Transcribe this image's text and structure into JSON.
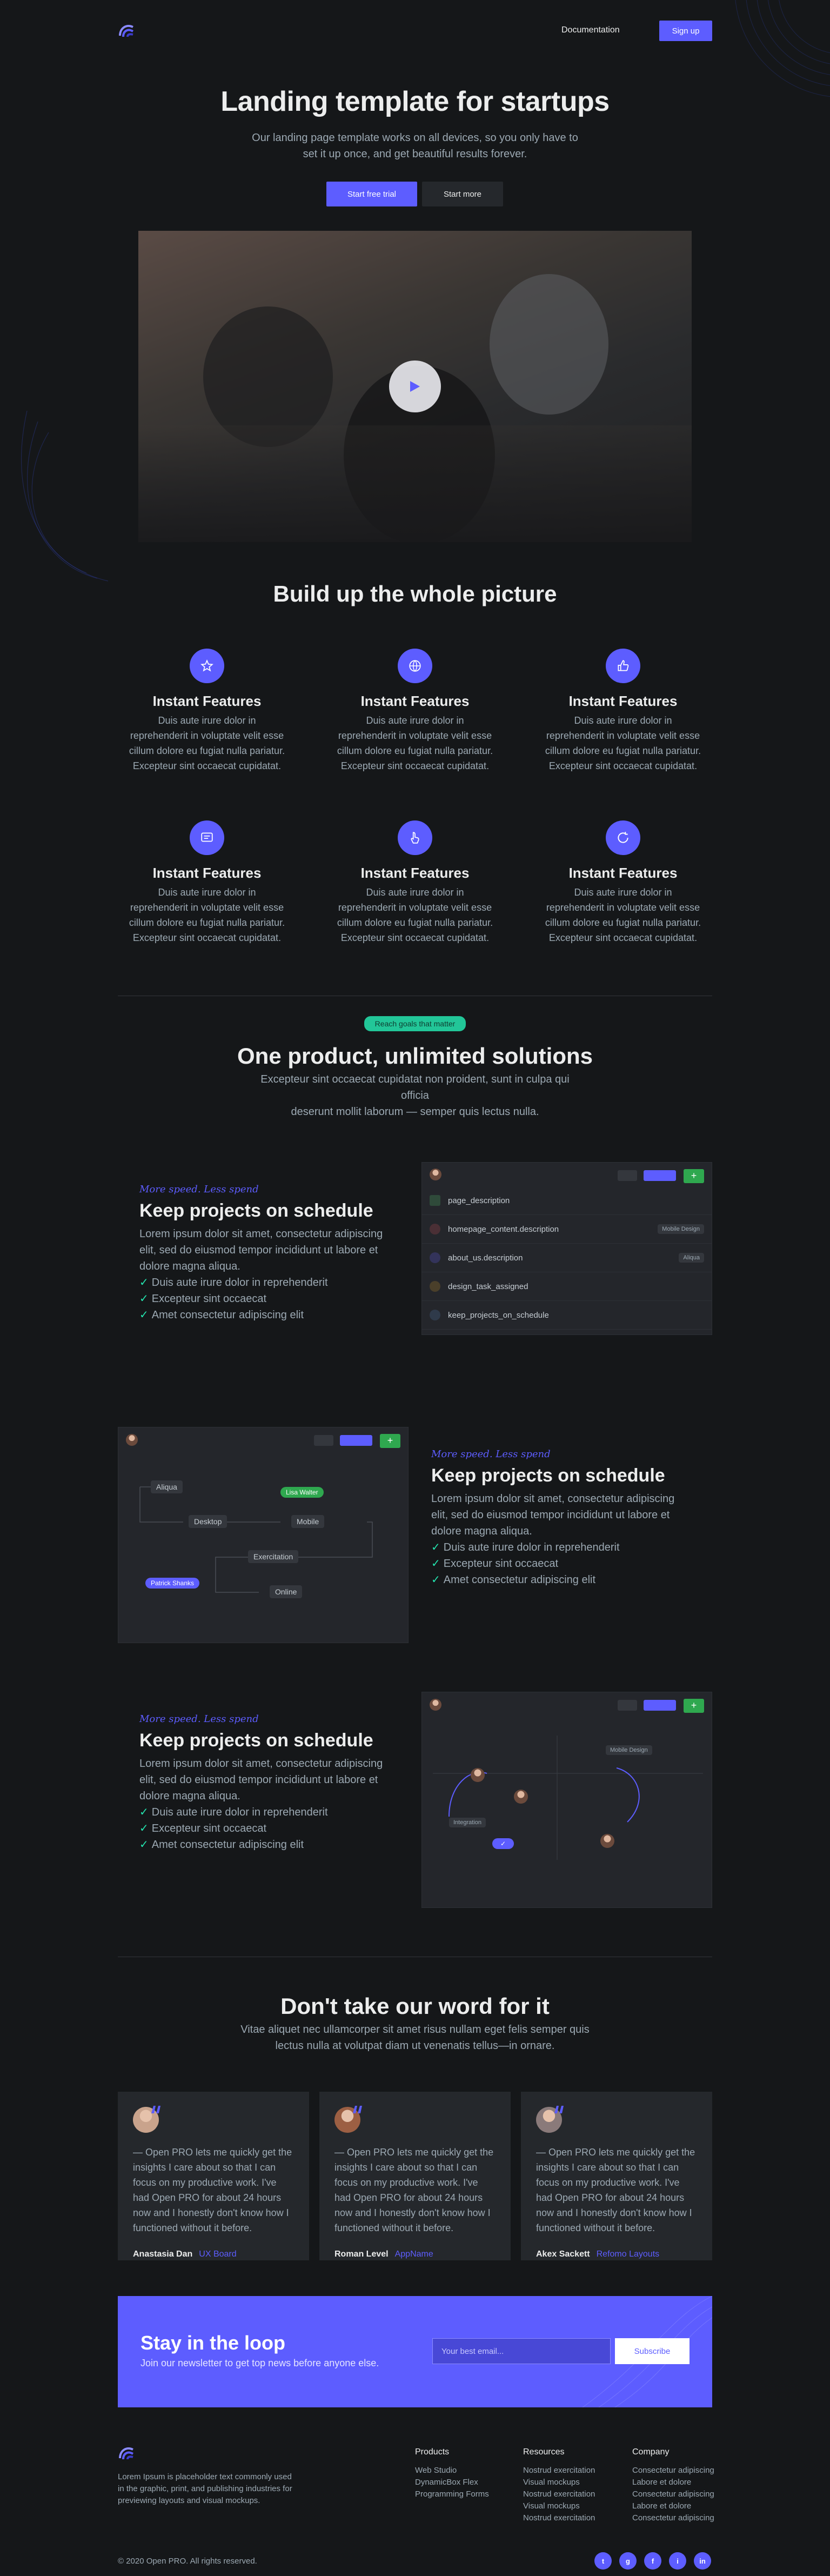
{
  "header": {
    "nav_link": "Documentation",
    "signup": "Sign up"
  },
  "hero": {
    "title": "Landing template for startups",
    "subtitle_line1": "Our landing page template works on all devices, so you only have to",
    "subtitle_line2": "set it up once, and get beautiful results forever.",
    "primary_cta": "Start free trial",
    "secondary_cta": "Start more"
  },
  "features": {
    "title": "Build up the whole picture",
    "items": [
      {
        "icon": "star-icon",
        "title": "Instant Features",
        "text": "Duis aute irure dolor in reprehenderit in voluptate velit esse cillum dolore eu fugiat nulla pariatur. Excepteur sint occaecat cupidatat."
      },
      {
        "icon": "globe-icon",
        "title": "Instant Features",
        "text": "Duis aute irure dolor in reprehenderit in voluptate velit esse cillum dolore eu fugiat nulla pariatur. Excepteur sint occaecat cupidatat."
      },
      {
        "icon": "thumbs-up-icon",
        "title": "Instant Features",
        "text": "Duis aute irure dolor in reprehenderit in voluptate velit esse cillum dolore eu fugiat nulla pariatur. Excepteur sint occaecat cupidatat."
      },
      {
        "icon": "message-icon",
        "title": "Instant Features",
        "text": "Duis aute irure dolor in reprehenderit in voluptate velit esse cillum dolore eu fugiat nulla pariatur. Excepteur sint occaecat cupidatat."
      },
      {
        "icon": "pointer-icon",
        "title": "Instant Features",
        "text": "Duis aute irure dolor in reprehenderit in voluptate velit esse cillum dolore eu fugiat nulla pariatur. Excepteur sint occaecat cupidatat."
      },
      {
        "icon": "refresh-icon",
        "title": "Instant Features",
        "text": "Duis aute irure dolor in reprehenderit in voluptate velit esse cillum dolore eu fugiat nulla pariatur. Excepteur sint occaecat cupidatat."
      }
    ]
  },
  "solutions": {
    "badge": "Reach goals that matter",
    "title": "One product, unlimited solutions",
    "text_line1": "Excepteur sint occaecat cupidatat non proident, sunt in culpa qui",
    "text_line2": "officia",
    "text_line3": "deserunt mollit laborum — semper quis lectus nulla."
  },
  "splits": [
    {
      "eyebrow": "More speed. Less spend",
      "title": "Keep projects on schedule",
      "text": "Lorem ipsum dolor sit amet, consectetur adipiscing elit, sed do eiusmod tempor incididunt ut labore et dolore magna aliqua.",
      "checks": [
        "Duis aute irure dolor in reprehenderit",
        "Excepteur sint occaecat",
        "Amet consectetur adipiscing elit"
      ]
    },
    {
      "eyebrow": "More speed. Less spend",
      "title": "Keep projects on schedule",
      "text": "Lorem ipsum dolor sit amet, consectetur adipiscing elit, sed do eiusmod tempor incididunt ut labore et dolore magna aliqua.",
      "checks": [
        "Duis aute irure dolor in reprehenderit",
        "Excepteur sint occaecat",
        "Amet consectetur adipiscing elit"
      ]
    },
    {
      "eyebrow": "More speed. Less spend",
      "title": "Keep projects on schedule",
      "text": "Lorem ipsum dolor sit amet, consectetur adipiscing elit, sed do eiusmod tempor incididunt ut labore et dolore magna aliqua.",
      "checks": [
        "Duis aute irure dolor in reprehenderit",
        "Excepteur sint occaecat",
        "Amet consectetur adipiscing elit"
      ]
    }
  ],
  "panel1": {
    "rows": [
      "page_description",
      "homepage_content.description",
      "about_us.description",
      "design_task_assigned",
      "keep_projects_on_schedule"
    ],
    "tag_mobile": "Mobile Design",
    "tag_aliqua": "Aliqua"
  },
  "panel2": {
    "nodes": [
      "Aliqua",
      "Desktop",
      "Mobile",
      "Exercitation",
      "Online"
    ],
    "pill_green": "Lisa Walter",
    "pill_purple": "Patrick Shanks"
  },
  "panel3": {
    "tag_mobile": "Mobile Design",
    "tag_integration": "Integration"
  },
  "testimonials": {
    "title": "Don't take our word for it",
    "sub_line1": "Vitae aliquet nec ullamcorper sit amet risus nullam eget felis semper quis",
    "sub_line2": "lectus nulla at volutpat diam ut venenatis tellus—in ornare.",
    "items": [
      {
        "text": "— Open PRO lets me quickly get the insights I care about so that I can focus on my productive work. I've had Open PRO for about 24 hours now and I honestly don't know how I functioned without it before.",
        "name": "Anastasia Dan",
        "role": "UX Board"
      },
      {
        "text": "— Open PRO lets me quickly get the insights I care about so that I can focus on my productive work. I've had Open PRO for about 24 hours now and I honestly don't know how I functioned without it before.",
        "name": "Roman Level",
        "role": "AppName"
      },
      {
        "text": "— Open PRO lets me quickly get the insights I care about so that I can focus on my productive work. I've had Open PRO for about 24 hours now and I honestly don't know how I functioned without it before.",
        "name": "Akex Sackett",
        "role": "Refomo Layouts"
      }
    ]
  },
  "cta": {
    "title": "Stay in the loop",
    "subtitle": "Join our newsletter to get top news before anyone else.",
    "placeholder": "Your best email...",
    "button": "Subscribe"
  },
  "footer": {
    "about": "Lorem Ipsum is placeholder text commonly used in the graphic, print, and publishing industries for previewing layouts and visual mockups.",
    "cols": [
      {
        "title": "Products",
        "links": [
          "Web Studio",
          "DynamicBox Flex",
          "Programming Forms"
        ]
      },
      {
        "title": "Resources",
        "links": [
          "Nostrud exercitation",
          "Visual mockups",
          "Nostrud exercitation",
          "Visual mockups",
          "Nostrud exercitation"
        ]
      },
      {
        "title": "Company",
        "links": [
          "Consectetur adipiscing",
          "Labore et dolore",
          "Consectetur adipiscing",
          "Labore et dolore",
          "Consectetur adipiscing"
        ]
      }
    ],
    "copyright": "© 2020 Open PRO. All rights reserved.",
    "socials": [
      "twitter-icon",
      "github-icon",
      "facebook-icon",
      "instagram-icon",
      "linkedin-icon"
    ]
  }
}
